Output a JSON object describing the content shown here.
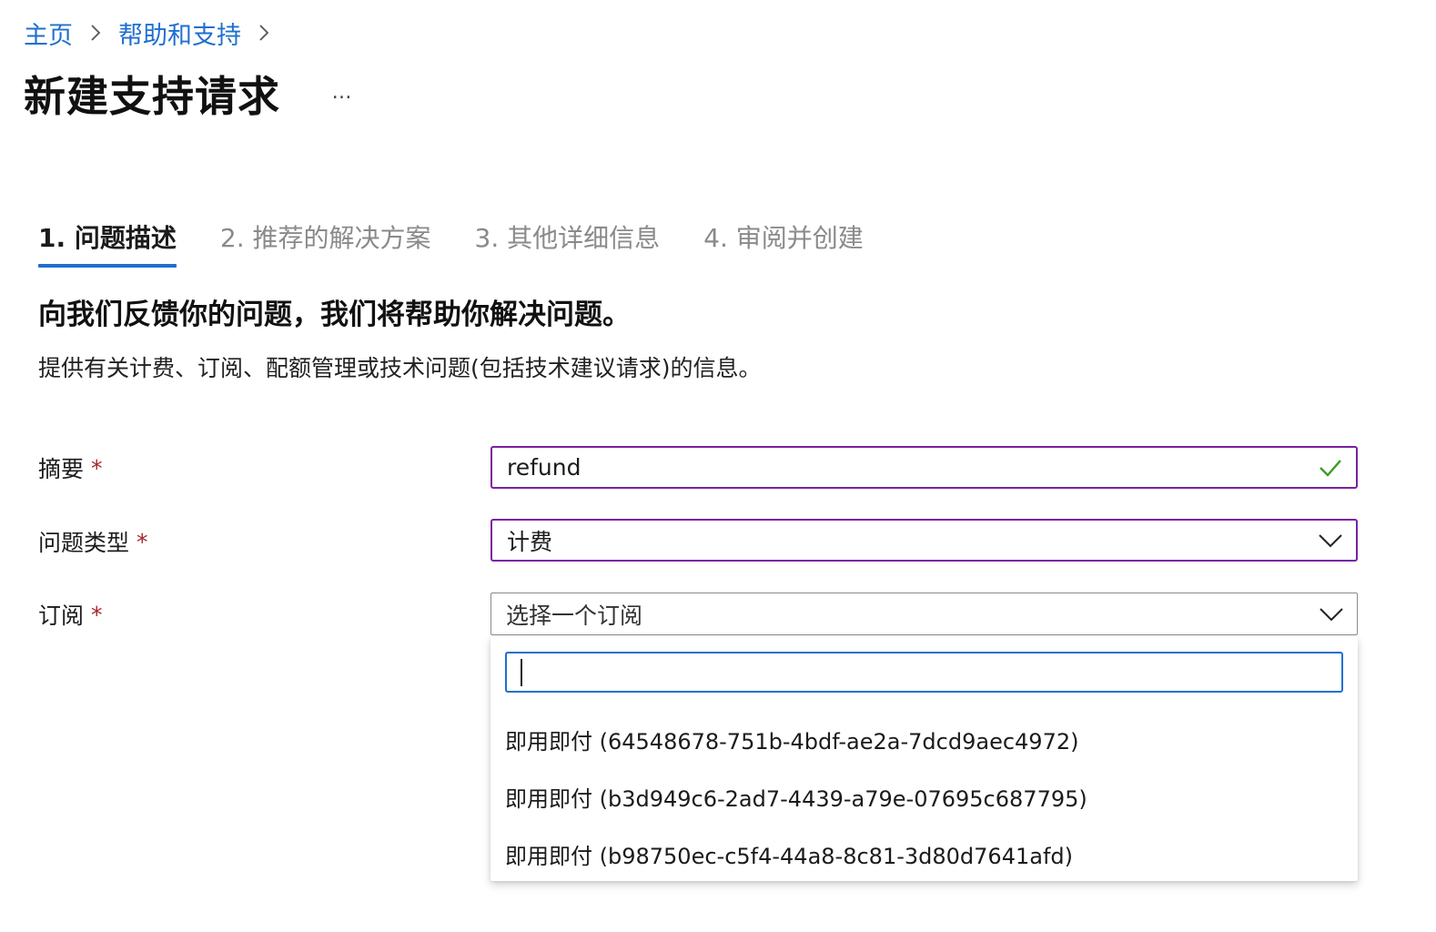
{
  "breadcrumb": {
    "home": "主页",
    "help_support": "帮助和支持"
  },
  "page": {
    "title": "新建支持请求",
    "more": "…"
  },
  "tabs": [
    {
      "label": "1. 问题描述",
      "active": true
    },
    {
      "label": "2. 推荐的解决方案",
      "active": false
    },
    {
      "label": "3. 其他详细信息",
      "active": false
    },
    {
      "label": "4. 审阅并创建",
      "active": false
    }
  ],
  "section": {
    "heading": "向我们反馈你的问题，我们将帮助你解决问题。",
    "description": "提供有关计费、订阅、配额管理或技术问题(包括技术建议请求)的信息。"
  },
  "form": {
    "summary": {
      "label": "摘要",
      "required": "*",
      "value": "refund",
      "status_icon": "checkmark-icon"
    },
    "problem_type": {
      "label": "问题类型",
      "required": "*",
      "value": "计费",
      "icon": "chevron-down-icon"
    },
    "subscription": {
      "label": "订阅",
      "required": "*",
      "placeholder": "选择一个订阅",
      "icon": "chevron-down-icon"
    }
  },
  "subscription_dropdown": {
    "search_value": "",
    "options": [
      "即用即付 (64548678-751b-4bdf-ae2a-7dcd9aec4972)",
      "即用即付 (b3d949c6-2ad7-4439-a79e-07695c687795)",
      "即用即付 (b98750ec-c5f4-44a8-8c81-3d80d7641afd)"
    ]
  },
  "colors": {
    "link": "#1f6fcf",
    "active_tab_underline": "#1f6fcf",
    "focused_border": "#7a1fa2",
    "search_border": "#1f6fcf",
    "required_star": "#a4262c",
    "valid_check": "#3a9d23",
    "inactive_tab": "#8a8a8a"
  }
}
